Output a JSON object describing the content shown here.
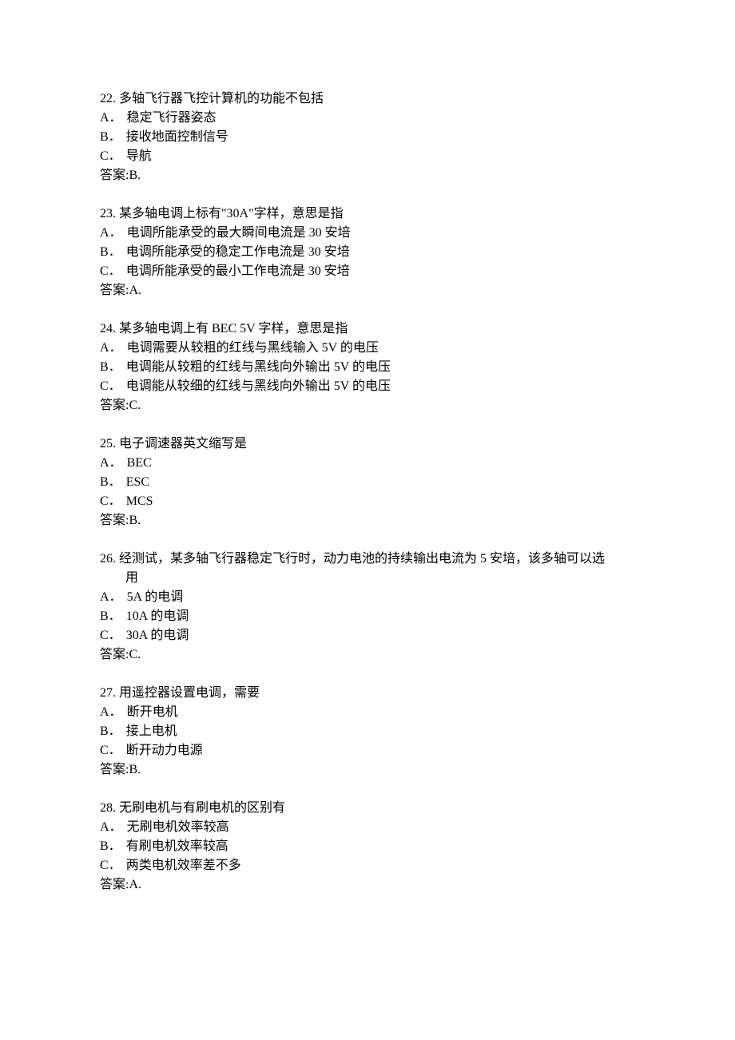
{
  "questions": [
    {
      "number": "22.",
      "stem": "多轴飞行器飞控计算机的功能不包括",
      "options": [
        {
          "letter": "A．",
          "text": "稳定飞行器姿态"
        },
        {
          "letter": "B．",
          "text": "接收地面控制信号"
        },
        {
          "letter": "C．",
          "text": "导航"
        }
      ],
      "answer": "答案:B."
    },
    {
      "number": "23.",
      "stem": "某多轴电调上标有\"30A\"字样，意思是指",
      "options": [
        {
          "letter": "A．",
          "text": "电调所能承受的最大瞬间电流是 30 安培"
        },
        {
          "letter": "B．",
          "text": "电调所能承受的稳定工作电流是 30 安培"
        },
        {
          "letter": "C．",
          "text": "电调所能承受的最小工作电流是 30 安培"
        }
      ],
      "answer": "答案:A."
    },
    {
      "number": "24.",
      "stem": "某多轴电调上有 BEC 5V 字样，意思是指",
      "options": [
        {
          "letter": "A．",
          "text": "电调需要从较粗的红线与黑线输入 5V 的电压"
        },
        {
          "letter": "B．",
          "text": "电调能从较粗的红线与黑线向外输出 5V 的电压"
        },
        {
          "letter": "C．",
          "text": "电调能从较细的红线与黑线向外输出 5V 的电压"
        }
      ],
      "answer": "答案:C."
    },
    {
      "number": "25.",
      "stem": "电子调速器英文缩写是",
      "options": [
        {
          "letter": "A．",
          "text": "BEC"
        },
        {
          "letter": "B．",
          "text": "ESC"
        },
        {
          "letter": "C．",
          "text": "MCS"
        }
      ],
      "answer": "答案:B."
    },
    {
      "number": "26.",
      "stem": "经测试，某多轴飞行器稳定飞行时，动力电池的持续输出电流为 5 安培，该多轴可以选",
      "stem_line2": "用",
      "options": [
        {
          "letter": "A．",
          "text": "5A 的电调"
        },
        {
          "letter": "B．",
          "text": "10A 的电调"
        },
        {
          "letter": "C．",
          "text": "30A 的电调"
        }
      ],
      "answer": "答案:C."
    },
    {
      "number": "27.",
      "stem": "用遥控器设置电调，需要",
      "options": [
        {
          "letter": "A．",
          "text": "断开电机"
        },
        {
          "letter": "B．",
          "text": "接上电机"
        },
        {
          "letter": "C．",
          "text": "断开动力电源"
        }
      ],
      "answer": "答案:B."
    },
    {
      "number": "28.",
      "stem": "无刷电机与有刷电机的区别有",
      "options": [
        {
          "letter": "A．",
          "text": "无刷电机效率较高"
        },
        {
          "letter": "B．",
          "text": "有刷电机效率较高"
        },
        {
          "letter": "C．",
          "text": "两类电机效率差不多"
        }
      ],
      "answer": "答案:A."
    }
  ]
}
